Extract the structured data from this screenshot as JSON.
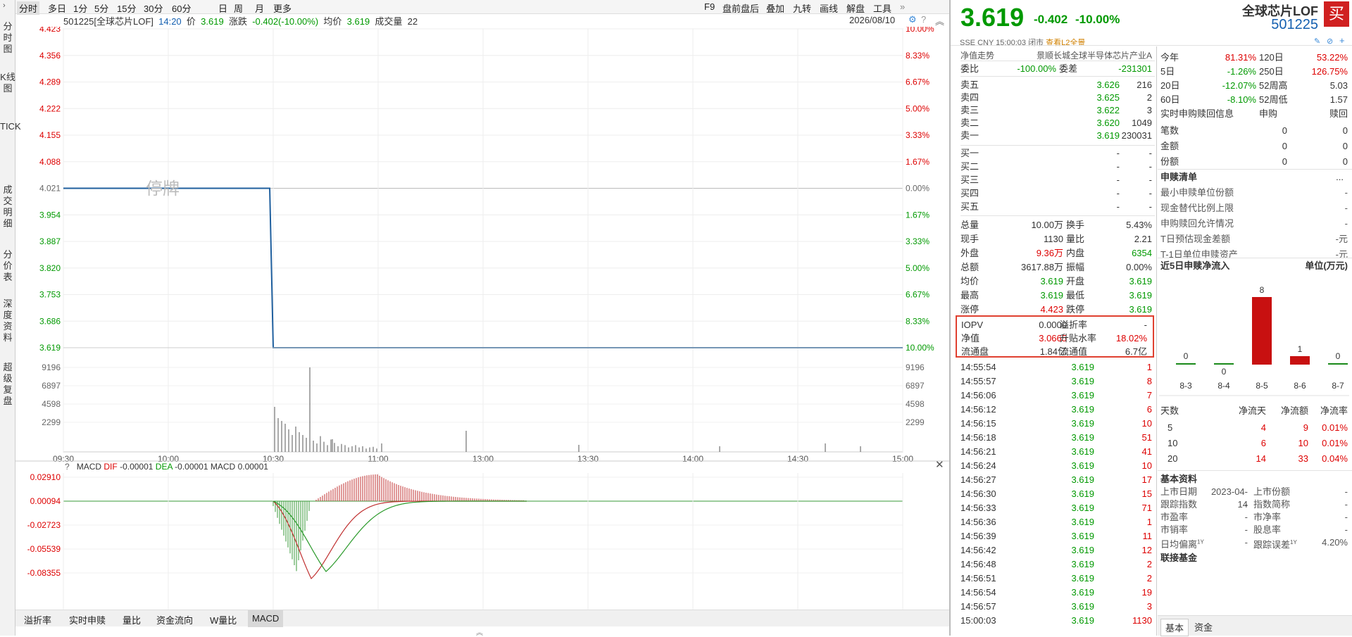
{
  "leftbar": {
    "items": [
      "分时图",
      "K线图",
      "TICK",
      "成交明细",
      "分价表",
      "深度资料",
      "超级复盘"
    ]
  },
  "topbar": {
    "periods": [
      "分时",
      "多日",
      "1分",
      "5分",
      "15分",
      "30分",
      "60分",
      "日",
      "周",
      "月",
      "更多"
    ],
    "tools": [
      "F9",
      "盘前盘后",
      "叠加",
      "九转",
      "画线",
      "解盘",
      "工具"
    ]
  },
  "info": {
    "code_name": "501225[全球芯片LOF]",
    "time": "14:20",
    "price_label": "价",
    "price": "3.619",
    "chg_label": "涨跌",
    "chg": "-0.402(-10.00%)",
    "avg_label": "均价",
    "avg": "3.619",
    "vol_label": "成交量",
    "vol": "22",
    "date": "2026/08/10"
  },
  "chart_data": {
    "type": "line",
    "xticks": [
      "09:30",
      "10:00",
      "10:30",
      "11:00",
      "13:00",
      "13:30",
      "14:00",
      "14:30",
      "15:00"
    ],
    "yticks_left": [
      "4.423",
      "4.356",
      "4.289",
      "4.222",
      "4.155",
      "4.088",
      "4.021",
      "3.954",
      "3.887",
      "3.820",
      "3.753",
      "3.686",
      "3.619"
    ],
    "yticks_right": [
      "10.00%",
      "8.33%",
      "6.67%",
      "5.00%",
      "3.33%",
      "1.67%",
      "0.00%",
      "1.67%",
      "3.33%",
      "5.00%",
      "6.67%",
      "8.33%",
      "10.00%"
    ],
    "ylim": [
      3.619,
      4.423
    ],
    "suspend_label": "停牌",
    "series": [
      {
        "values_x": [
          "09:30",
          "10:29",
          "10:30",
          "15:00"
        ],
        "values_y": [
          4.021,
          4.021,
          3.619,
          3.619
        ]
      }
    ],
    "vol_ticks": [
      "9196",
      "6897",
      "4598",
      "2299"
    ],
    "macd": {
      "header": "MACD",
      "dif_label": "DIF",
      "dif": "-0.00001",
      "dea_label": "DEA",
      "dea": "-0.00001",
      "macd_label": "MACD",
      "macd": "0.00001",
      "yticks": [
        "0.02910",
        "0.00094",
        "-0.02723",
        "-0.05539",
        "-0.08355"
      ]
    }
  },
  "bottomtabs": [
    "溢折率",
    "实时申赎",
    "量比",
    "资金流向",
    "W量比",
    "MACD"
  ],
  "quote": {
    "price": "3.619",
    "chg": "-0.402",
    "pct": "-10.00%",
    "name": "全球芯片LOF",
    "code": "501225",
    "exch": "SSE",
    "cur": "CNY",
    "ts": "15:00:03",
    "status": "闭市",
    "l2": "查看L2全景",
    "buy": "买"
  },
  "nav": {
    "label": "净值走势",
    "fund": "景顺长城全球半导体芯片产业A"
  },
  "weibi": {
    "l1": "委比",
    "v1": "-100.00%",
    "l2": "委差",
    "v2": "-231301"
  },
  "asks": [
    {
      "l": "卖五",
      "p": "3.626",
      "v": "216"
    },
    {
      "l": "卖四",
      "p": "3.625",
      "v": "2"
    },
    {
      "l": "卖三",
      "p": "3.622",
      "v": "3"
    },
    {
      "l": "卖二",
      "p": "3.620",
      "v": "1049"
    },
    {
      "l": "卖一",
      "p": "3.619",
      "v": "230031"
    }
  ],
  "bids": [
    {
      "l": "买一",
      "p": "-",
      "v": "-"
    },
    {
      "l": "买二",
      "p": "-",
      "v": "-"
    },
    {
      "l": "买三",
      "p": "-",
      "v": "-"
    },
    {
      "l": "买四",
      "p": "-",
      "v": "-"
    },
    {
      "l": "买五",
      "p": "-",
      "v": "-"
    }
  ],
  "stats": [
    [
      "总量",
      "10.00万",
      "换手",
      "5.43%"
    ],
    [
      "现手",
      "1130",
      "量比",
      "2.21"
    ],
    [
      "外盘",
      "9.36万",
      "内盘",
      "6354"
    ],
    [
      "总额",
      "3617.88万",
      "振幅",
      "0.00%"
    ],
    [
      "均价",
      "3.619",
      "开盘",
      "3.619"
    ],
    [
      "最高",
      "3.619",
      "最低",
      "3.619"
    ],
    [
      "涨停",
      "4.423",
      "跌停",
      "3.619"
    ]
  ],
  "iopv": [
    [
      "IOPV",
      "0.0000",
      "溢折率",
      "-"
    ],
    [
      "净值",
      "3.0665",
      "升贴水率",
      "18.02%"
    ],
    [
      "流通盘",
      "1.84亿",
      "流通值",
      "6.7亿"
    ]
  ],
  "ticks": [
    [
      "14:55:54",
      "3.619",
      "1"
    ],
    [
      "14:55:57",
      "3.619",
      "8"
    ],
    [
      "14:56:06",
      "3.619",
      "7"
    ],
    [
      "14:56:12",
      "3.619",
      "6"
    ],
    [
      "14:56:15",
      "3.619",
      "10"
    ],
    [
      "14:56:18",
      "3.619",
      "51"
    ],
    [
      "14:56:21",
      "3.619",
      "41"
    ],
    [
      "14:56:24",
      "3.619",
      "10"
    ],
    [
      "14:56:27",
      "3.619",
      "17"
    ],
    [
      "14:56:30",
      "3.619",
      "15"
    ],
    [
      "14:56:33",
      "3.619",
      "71"
    ],
    [
      "14:56:36",
      "3.619",
      "1"
    ],
    [
      "14:56:39",
      "3.619",
      "11"
    ],
    [
      "14:56:42",
      "3.619",
      "12"
    ],
    [
      "14:56:48",
      "3.619",
      "2"
    ],
    [
      "14:56:51",
      "3.619",
      "2"
    ],
    [
      "14:56:54",
      "3.619",
      "19"
    ],
    [
      "14:56:57",
      "3.619",
      "3"
    ],
    [
      "15:00:03",
      "3.619",
      "1130"
    ]
  ],
  "perf": [
    [
      "今年",
      "81.31%",
      "120日",
      "53.22%"
    ],
    [
      "5日",
      "-1.26%",
      "250日",
      "126.75%"
    ],
    [
      "20日",
      "-12.07%",
      "52周高",
      "5.03"
    ],
    [
      "60日",
      "-8.10%",
      "52周低",
      "1.57"
    ]
  ],
  "sg": {
    "title": "实时申购赎回信息",
    "h1": "申购",
    "h2": "赎回",
    "rows": [
      [
        "笔数",
        "0",
        "0"
      ],
      [
        "金额",
        "0",
        "0"
      ],
      [
        "份额",
        "0",
        "0"
      ]
    ]
  },
  "sglist": {
    "title": "申赎清单",
    "more": "...",
    "rows": [
      [
        "最小申赎单位份额",
        "-"
      ],
      [
        "现金替代比例上限",
        "-"
      ],
      [
        "申购赎回允许情况",
        "-"
      ],
      [
        "T日预估现金差额",
        "-元"
      ],
      [
        "T-1日单位申赎资产",
        "-元"
      ]
    ]
  },
  "flow": {
    "title": "近5日申赎净流入",
    "unit": "单位(万元)",
    "bars": [
      {
        "d": "8-3",
        "v": 0
      },
      {
        "d": "8-4",
        "v": 0
      },
      {
        "d": "8-5",
        "v": 8
      },
      {
        "d": "8-6",
        "v": 1
      },
      {
        "d": "8-7",
        "v": 0
      }
    ],
    "cols": [
      "天数",
      "净流天",
      "净流额",
      "净流率"
    ],
    "rows": [
      [
        "5",
        "4",
        "9",
        "0.01%"
      ],
      [
        "10",
        "6",
        "10",
        "0.01%"
      ],
      [
        "20",
        "14",
        "33",
        "0.04%"
      ]
    ]
  },
  "basic": {
    "title": "基本资料",
    "rows": [
      [
        "上市日期",
        "2023-04-14",
        "上市份额",
        "-"
      ],
      [
        "跟踪指数",
        "-",
        "指数简称",
        "-"
      ],
      [
        "市盈率",
        "-",
        "市净率",
        "-"
      ],
      [
        "市销率",
        "-",
        "股息率",
        "-"
      ],
      [
        "日均偏离",
        "-",
        "跟踪误差",
        "4.20%"
      ]
    ],
    "sup": "1Y",
    "related": "联接基金"
  },
  "rtabs": [
    "基本",
    "资金"
  ]
}
